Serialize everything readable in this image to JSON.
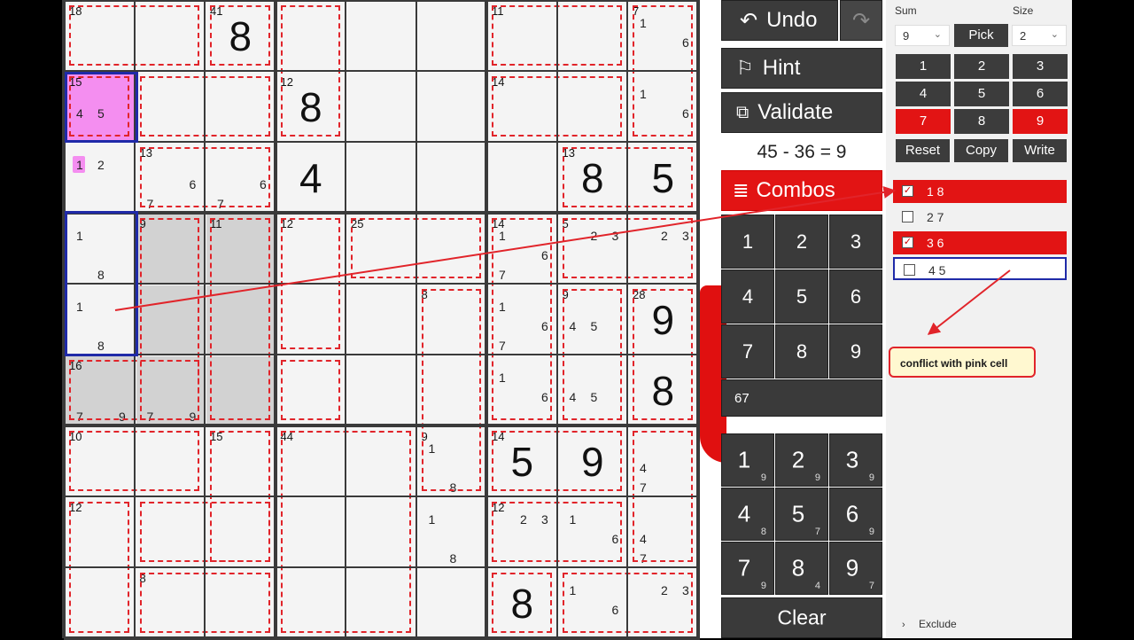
{
  "grid": {
    "cells": [
      {
        "r": 0,
        "c": 0,
        "sum": "18"
      },
      {
        "r": 0,
        "c": 2,
        "sum": "41",
        "value": "8"
      },
      {
        "r": 0,
        "c": 6,
        "sum": "11"
      },
      {
        "r": 0,
        "c": 8,
        "sum": "7",
        "cands": [
          "1",
          "6"
        ]
      },
      {
        "r": 1,
        "c": 0,
        "sum": "15",
        "cands": [
          "4",
          "5"
        ],
        "highlight": "pink"
      },
      {
        "r": 1,
        "c": 3,
        "sum": "12",
        "value": "8"
      },
      {
        "r": 1,
        "c": 6,
        "sum": "14"
      },
      {
        "r": 1,
        "c": 8,
        "cands": [
          "1",
          "6"
        ]
      },
      {
        "r": 2,
        "c": 0,
        "cands": [
          "1",
          "2"
        ],
        "mark": "1"
      },
      {
        "r": 2,
        "c": 1,
        "sum": "13",
        "cands": [
          "6",
          "7"
        ]
      },
      {
        "r": 2,
        "c": 2,
        "cands": [
          "6",
          "7"
        ]
      },
      {
        "r": 2,
        "c": 3,
        "value": "4"
      },
      {
        "r": 2,
        "c": 7,
        "sum": "13",
        "value": "8"
      },
      {
        "r": 2,
        "c": 8,
        "value": "5"
      },
      {
        "r": 3,
        "c": 0,
        "cands": [
          "1",
          "8"
        ]
      },
      {
        "r": 3,
        "c": 1,
        "sum": "9",
        "highlight": "gray"
      },
      {
        "r": 3,
        "c": 2,
        "sum": "11",
        "highlight": "gray"
      },
      {
        "r": 3,
        "c": 3,
        "sum": "12"
      },
      {
        "r": 3,
        "c": 4,
        "sum": "25"
      },
      {
        "r": 3,
        "c": 6,
        "sum": "14",
        "cands": [
          "1",
          "6",
          "7"
        ]
      },
      {
        "r": 3,
        "c": 7,
        "sum": "5",
        "cands": [
          "2",
          "3"
        ]
      },
      {
        "r": 3,
        "c": 8,
        "cands": [
          "2",
          "3"
        ]
      },
      {
        "r": 4,
        "c": 0,
        "cands": [
          "1",
          "8"
        ]
      },
      {
        "r": 4,
        "c": 1,
        "highlight": "gray"
      },
      {
        "r": 4,
        "c": 2,
        "highlight": "gray"
      },
      {
        "r": 4,
        "c": 5,
        "sum": "8"
      },
      {
        "r": 4,
        "c": 6,
        "cands": [
          "1",
          "6",
          "7"
        ]
      },
      {
        "r": 4,
        "c": 7,
        "sum": "9",
        "cands": [
          "4",
          "5"
        ]
      },
      {
        "r": 4,
        "c": 8,
        "sum": "28",
        "value": "9"
      },
      {
        "r": 5,
        "c": 0,
        "sum": "16",
        "cands": [
          "7",
          "9"
        ],
        "highlight": "gray"
      },
      {
        "r": 5,
        "c": 1,
        "cands": [
          "7",
          "9"
        ],
        "highlight": "gray"
      },
      {
        "r": 5,
        "c": 2,
        "highlight": "gray"
      },
      {
        "r": 5,
        "c": 6,
        "cands": [
          "1",
          "6"
        ]
      },
      {
        "r": 5,
        "c": 7,
        "cands": [
          "4",
          "5"
        ]
      },
      {
        "r": 5,
        "c": 8,
        "value": "8"
      },
      {
        "r": 6,
        "c": 0,
        "sum": "10"
      },
      {
        "r": 6,
        "c": 2,
        "sum": "15"
      },
      {
        "r": 6,
        "c": 3,
        "sum": "44"
      },
      {
        "r": 6,
        "c": 5,
        "sum": "9",
        "cands": [
          "1",
          "8"
        ]
      },
      {
        "r": 6,
        "c": 6,
        "sum": "14",
        "value": "5"
      },
      {
        "r": 6,
        "c": 7,
        "value": "9"
      },
      {
        "r": 6,
        "c": 8,
        "cands": [
          "4",
          "7"
        ]
      },
      {
        "r": 7,
        "c": 0,
        "sum": "12"
      },
      {
        "r": 7,
        "c": 5,
        "cands": [
          "1",
          "8"
        ]
      },
      {
        "r": 7,
        "c": 6,
        "sum": "12",
        "cands": [
          "2",
          "3"
        ]
      },
      {
        "r": 7,
        "c": 7,
        "cands": [
          "1",
          "6"
        ]
      },
      {
        "r": 7,
        "c": 8,
        "cands": [
          "4",
          "7"
        ]
      },
      {
        "r": 8,
        "c": 1,
        "sum": "8"
      },
      {
        "r": 8,
        "c": 6,
        "value": "8"
      },
      {
        "r": 8,
        "c": 7,
        "cands": [
          "1",
          "6"
        ]
      },
      {
        "r": 8,
        "c": 8,
        "cands": [
          "2",
          "3"
        ]
      }
    ]
  },
  "controls": {
    "undo": "Undo",
    "hint": "Hint",
    "validate": "Validate",
    "equation": "45 - 36 = 9",
    "combos": "Combos",
    "keypad": [
      "1",
      "2",
      "3",
      "4",
      "5",
      "6",
      "7",
      "8",
      "9"
    ],
    "keypad_field": "67",
    "digits": [
      {
        "d": "1",
        "n": "9"
      },
      {
        "d": "2",
        "n": "9"
      },
      {
        "d": "3",
        "n": "9"
      },
      {
        "d": "4",
        "n": "8"
      },
      {
        "d": "5",
        "n": "7"
      },
      {
        "d": "6",
        "n": "9"
      },
      {
        "d": "7",
        "n": "9"
      },
      {
        "d": "8",
        "n": "4"
      },
      {
        "d": "9",
        "n": "7"
      }
    ],
    "clear": "Clear"
  },
  "side": {
    "sum_label": "Sum",
    "size_label": "Size",
    "sum_value": "9",
    "pick": "Pick",
    "size_value": "2",
    "numbers": [
      "1",
      "2",
      "3",
      "4",
      "5",
      "6",
      "7",
      "8",
      "9"
    ],
    "selected_numbers": [
      "7",
      "9"
    ],
    "reset": "Reset",
    "copy": "Copy",
    "write": "Write",
    "combos": [
      {
        "text": "1 8",
        "checked": true
      },
      {
        "text": "2 7",
        "checked": false
      },
      {
        "text": "3 6",
        "checked": true
      },
      {
        "text": "4 5",
        "checked": false
      }
    ],
    "exclude": "Exclude",
    "callout": "conflict with pink cell"
  },
  "colors": {
    "accent": "#e21414",
    "selection": "#1f2aa8",
    "pink": "#f48ef0",
    "gray": "#d2d2d2",
    "button": "#3b3b3b"
  }
}
